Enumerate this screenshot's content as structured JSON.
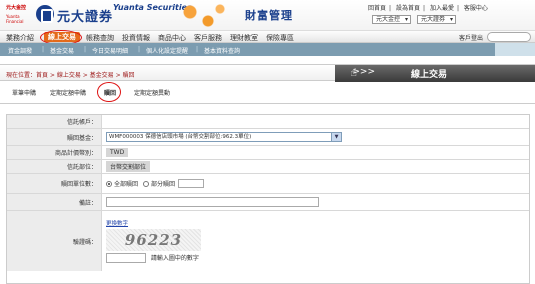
{
  "header": {
    "logo_line1": "元大金控",
    "logo_line2": "Yuanta Financial",
    "brand_cn": "元大證券",
    "brand_en": "Yuanta Securities",
    "page_title": "財富管理",
    "top_links": [
      "回首頁",
      "設為首頁",
      "加入最愛",
      "客服中心"
    ],
    "user_select_1": "元大金控",
    "user_select_2": "元大證券"
  },
  "nav": {
    "items": [
      "業務介紹",
      "線上交易",
      "帳務查詢",
      "投資情報",
      "商品中心",
      "客戶服務",
      "理財教室",
      "保險專區"
    ],
    "active_index": 1,
    "logout_label": "客戶登出"
  },
  "subnav": {
    "items": [
      "資金調撥",
      "基金交易",
      "今日交易明細",
      "個人化設定提醒",
      "基本資料查詢"
    ]
  },
  "breadcrumb": {
    "text": "現在位置：首頁 > 線上交易 > 基金交易 > 贖回",
    "section_title": "線上交易"
  },
  "tabs": {
    "items": [
      "單筆申購",
      "定期定額申購",
      "贖回",
      "定期定額異動"
    ],
    "active_index": 2
  },
  "form": {
    "account_label": "信託帳戶：",
    "account_value": "",
    "fund_label": "贖回基金：",
    "fund_value": "WMF000003 保德信店頭市場 (台幣交割部位:962.3單位)",
    "currency_label": "商品計價幣別：",
    "currency_value": "TWD",
    "position_label": "信託部位：",
    "position_value": "台幣交割部位",
    "units_label": "贖回單位數：",
    "full_redeem_label": "全部贖回",
    "partial_redeem_label": "部分贖回",
    "note_label": "備註：",
    "captcha_label": "驗證碼：",
    "refresh_label": "更換數字",
    "captcha_text": "96223",
    "captcha_hint": "請輸入圖中的數字"
  }
}
